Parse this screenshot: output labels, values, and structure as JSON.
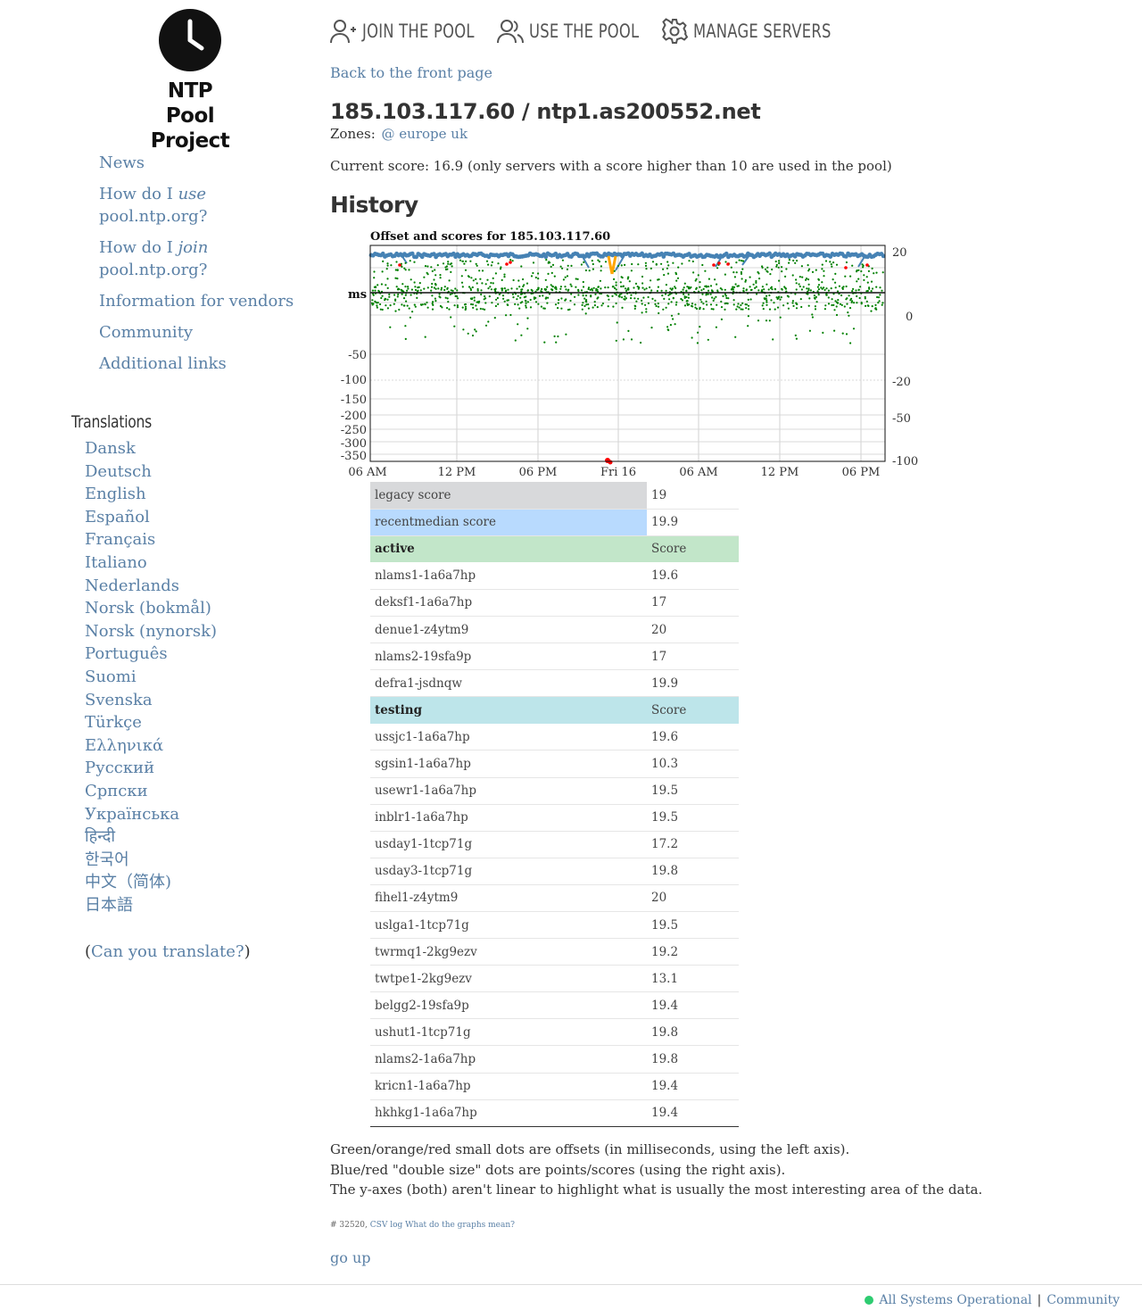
{
  "logo": {
    "line1": "NTP Pool",
    "line2": "Project",
    "icon": "clock-icon"
  },
  "topnav": {
    "join": "JOIN THE POOL",
    "use": "USE THE POOL",
    "manage": "MANAGE SERVERS"
  },
  "sidenav": {
    "news": "News",
    "how_use_pre": "How do I ",
    "how_use_em": "use",
    "how_use_post": "pool.ntp.org?",
    "how_join_pre": "How do I ",
    "how_join_em": "join",
    "how_join_post": "pool.ntp.org?",
    "vendors": "Information for vendors",
    "community": "Community",
    "links": "Additional links"
  },
  "translations": {
    "title": "Translations",
    "languages": [
      "Dansk",
      "Deutsch",
      "English",
      "Español",
      "Français",
      "Italiano",
      "Nederlands",
      "Norsk (bokmål)",
      "Norsk (nynorsk)",
      "Português",
      "Suomi",
      "Svenska",
      "Türkçe",
      "Ελληνικά",
      "Русский",
      "Српски",
      "Українська",
      "हिन्दी",
      "한국어",
      "中文（简体)",
      "日本語"
    ],
    "ask_open": "(",
    "ask_link": "Can you translate?",
    "ask_close": ")"
  },
  "page": {
    "back": "Back to the front page",
    "title": "185.103.117.60 / ntp1.as200552.net",
    "zones_label": "Zones:",
    "zones": "@ europe uk",
    "current_score": "Current score: 16.9 (only servers with a score higher than 10 are used in the pool)",
    "history": "History"
  },
  "chart_data": {
    "type": "scatter",
    "title": "Offset and scores for 185.103.117.60",
    "ylabel": "ms",
    "x_ticks": [
      "06 AM",
      "12 PM",
      "06 PM",
      "Fri 16",
      "06 AM",
      "12 PM",
      "06 PM"
    ],
    "y_left_ticks": [
      "-50",
      "-100",
      "-150",
      "-200",
      "-250",
      "-300",
      "-350"
    ],
    "y_right_ticks": [
      "20",
      "0",
      "-20",
      "-50",
      "-100"
    ],
    "grid": true,
    "series": [
      {
        "color": "#4682b4"
      },
      {
        "color": "#008000"
      },
      {
        "color": "#ff0000"
      },
      {
        "color": "#ffa500"
      }
    ]
  },
  "scores": {
    "legacy_label": "legacy score",
    "legacy_value": "19",
    "recent_label": "recentmedian score",
    "recent_value": "19.9",
    "active_label": "active",
    "score_header": "Score",
    "active": [
      {
        "name": "nlams1-1a6a7hp",
        "score": "19.6"
      },
      {
        "name": "deksf1-1a6a7hp",
        "score": "17"
      },
      {
        "name": "denue1-z4ytm9",
        "score": "20"
      },
      {
        "name": "nlams2-19sfa9p",
        "score": "17"
      },
      {
        "name": "defra1-jsdnqw",
        "score": "19.9"
      }
    ],
    "testing_label": "testing",
    "testing": [
      {
        "name": "ussjc1-1a6a7hp",
        "score": "19.6"
      },
      {
        "name": "sgsin1-1a6a7hp",
        "score": "10.3"
      },
      {
        "name": "usewr1-1a6a7hp",
        "score": "19.5"
      },
      {
        "name": "inblr1-1a6a7hp",
        "score": "19.5"
      },
      {
        "name": "usday1-1tcp71g",
        "score": "17.2"
      },
      {
        "name": "usday3-1tcp71g",
        "score": "19.8"
      },
      {
        "name": "fihel1-z4ytm9",
        "score": "20"
      },
      {
        "name": "uslga1-1tcp71g",
        "score": "19.5"
      },
      {
        "name": "twrmq1-2kg9ezv",
        "score": "19.2"
      },
      {
        "name": "twtpe1-2kg9ezv",
        "score": "13.1"
      },
      {
        "name": "belgg2-19sfa9p",
        "score": "19.4"
      },
      {
        "name": "ushut1-1tcp71g",
        "score": "19.8"
      },
      {
        "name": "nlams2-1a6a7hp",
        "score": "19.8"
      },
      {
        "name": "kricn1-1a6a7hp",
        "score": "19.4"
      },
      {
        "name": "hkhkg1-1a6a7hp",
        "score": "19.4"
      }
    ]
  },
  "legend": {
    "line1": "Green/orange/red small dots are offsets (in milliseconds, using the left axis).",
    "line2": "Blue/red \"double size\" dots are points/scores (using the right axis).",
    "line3": "The y-axes (both) aren't linear to highlight what is usually the most interesting area of the data."
  },
  "meta": {
    "id": "# 32520,",
    "csv": "CSV log",
    "what": "What do the graphs mean?"
  },
  "go_up": "go up",
  "footer": {
    "status": "All Systems Operational",
    "sep": "|",
    "community": "Community"
  }
}
